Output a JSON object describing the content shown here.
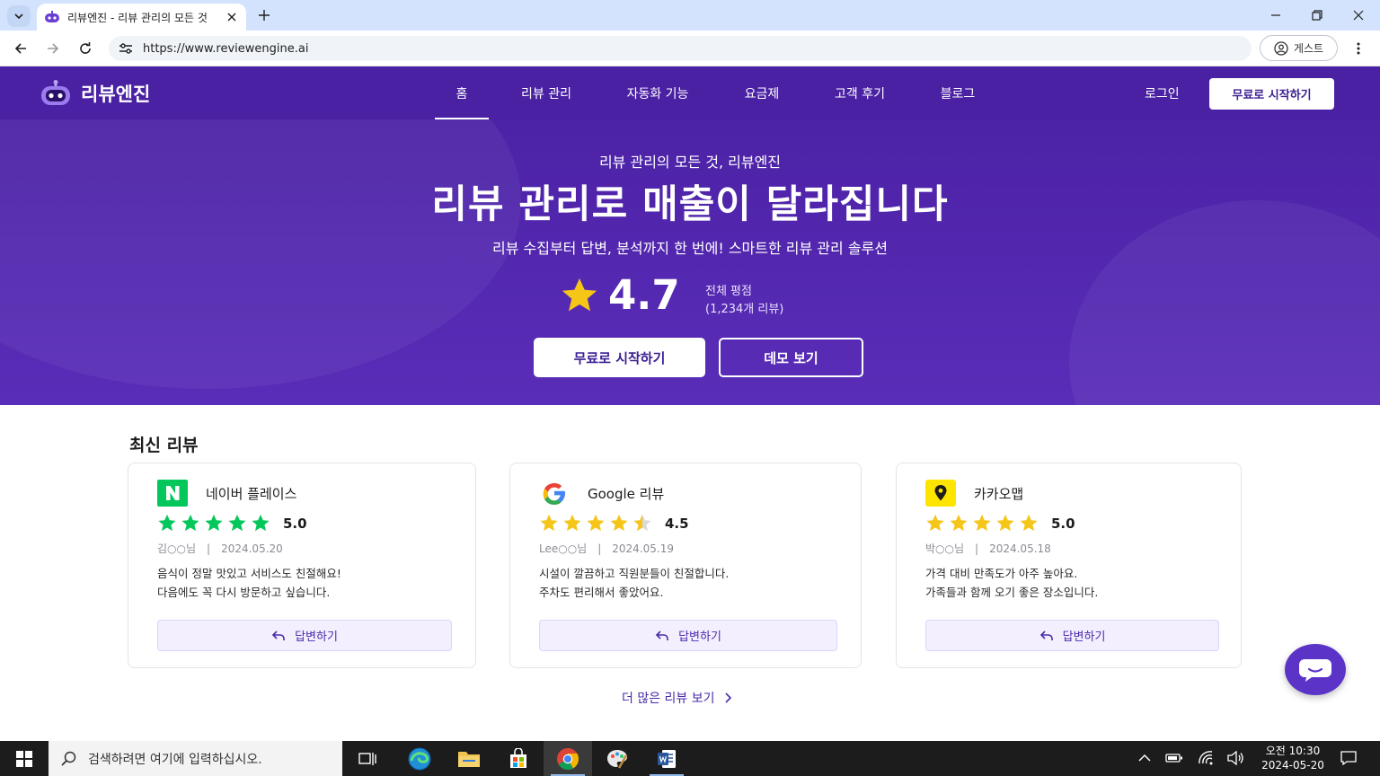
{
  "browser": {
    "tab_title": "리뷰엔진 - 리뷰 관리의 모든 것",
    "url": "https://www.reviewengine.ai",
    "profile_label": "게스트"
  },
  "site": {
    "logo_text": "리뷰엔진",
    "nav": [
      "홈",
      "리뷰 관리",
      "자동화 기능",
      "요금제",
      "고객 후기",
      "블로그"
    ],
    "active_nav": "홈",
    "login": "로그인",
    "header_cta": "무료로 시작하기"
  },
  "hero": {
    "eyebrow": "리뷰 관리의 모든 것, 리뷰엔진",
    "title": "리뷰 관리로 매출이 달라집니다",
    "subtitle": "리뷰 수집부터 답변, 분석까지 한 번에! 스마트한 리뷰 관리 솔루션",
    "rating": "4.7",
    "rating_label": "전체 평점",
    "rating_count": "(1,234개 리뷰)",
    "primary_button": "무료로 시작하기",
    "secondary_button": "데모 보기"
  },
  "reviews": {
    "section_title": "최신 리뷰",
    "items": [
      {
        "platform": "네이버 플레이스",
        "score": "5.0",
        "stars": 5,
        "author": "김○○님",
        "date": "2024.05.20",
        "text_line1": "음식이 정말 맛있고 서비스도 친절해요!",
        "text_line2": "다음에도 꼭 다시 방문하고 싶습니다.",
        "reply_label": "답변하기"
      },
      {
        "platform": "Google 리뷰",
        "score": "4.5",
        "stars": 4.5,
        "author": "Lee○○님",
        "date": "2024.05.19",
        "text_line1": "시설이 깔끔하고 직원분들이 친절합니다.",
        "text_line2": "주차도 편리해서 좋았어요.",
        "reply_label": "답변하기"
      },
      {
        "platform": "카카오맵",
        "score": "5.0",
        "stars": 5,
        "author": "박○○님",
        "date": "2024.05.18",
        "text_line1": "가격 대비 만족도가 아주 높아요.",
        "text_line2": "가족들과 함께 오기 좋은 장소입니다.",
        "reply_label": "답변하기"
      }
    ],
    "more_link": "더 많은 리뷰 보기"
  },
  "taskbar": {
    "search_placeholder": "검색하려면 여기에 입력하십시오.",
    "time": "오전 10:30",
    "date": "2024-05-20"
  },
  "colors": {
    "brand": "#4a21a3",
    "brand_light": "#f3efff",
    "star": "#f5c518",
    "naver_green": "#03c75a",
    "kakao_yellow": "#fee500"
  }
}
